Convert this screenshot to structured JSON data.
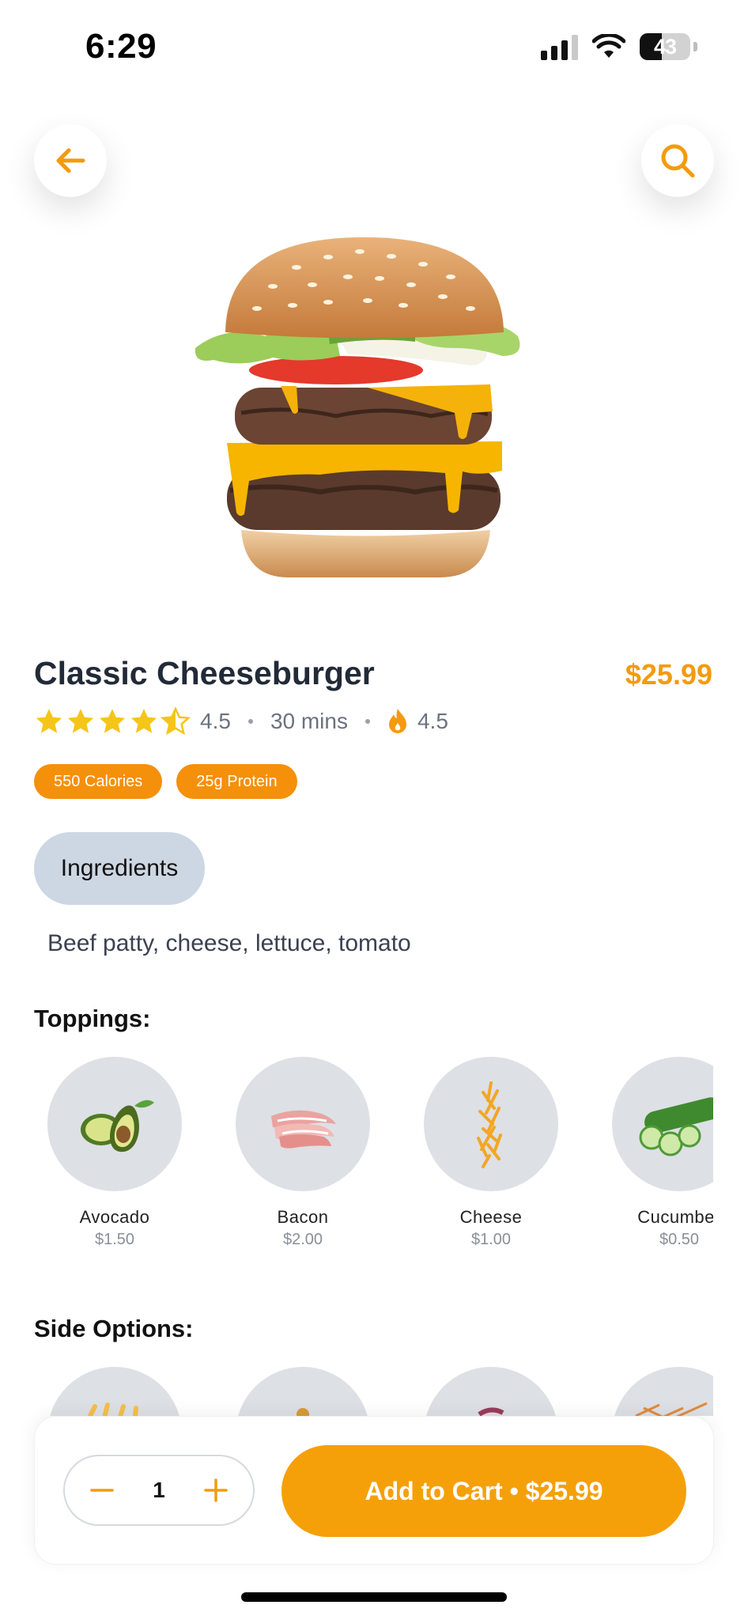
{
  "status_bar": {
    "time": "6:29",
    "battery": "43"
  },
  "header": {
    "back_icon": "arrow-left-icon",
    "search_icon": "search-icon",
    "accent_color": "#f39b0d"
  },
  "product": {
    "name": "Classic Cheeseburger",
    "price": "$25.99",
    "rating": "4.5",
    "rating_stars": 4.5,
    "time": "30 mins",
    "spice_level": "4.5",
    "badges": [
      "550 Calories",
      "25g Protein"
    ]
  },
  "ingredients": {
    "tab_label": "Ingredients",
    "text": "Beef patty, cheese, lettuce, tomato"
  },
  "toppings": {
    "title": "Toppings:",
    "items": [
      {
        "name": "Avocado",
        "price": "$1.50"
      },
      {
        "name": "Bacon",
        "price": "$2.00"
      },
      {
        "name": "Cheese",
        "price": "$1.00"
      },
      {
        "name": "Cucumber",
        "price": "$0.50"
      }
    ]
  },
  "sides": {
    "title": "Side Options:"
  },
  "cart": {
    "quantity": "1",
    "button_label": "Add to Cart • $25.99"
  }
}
